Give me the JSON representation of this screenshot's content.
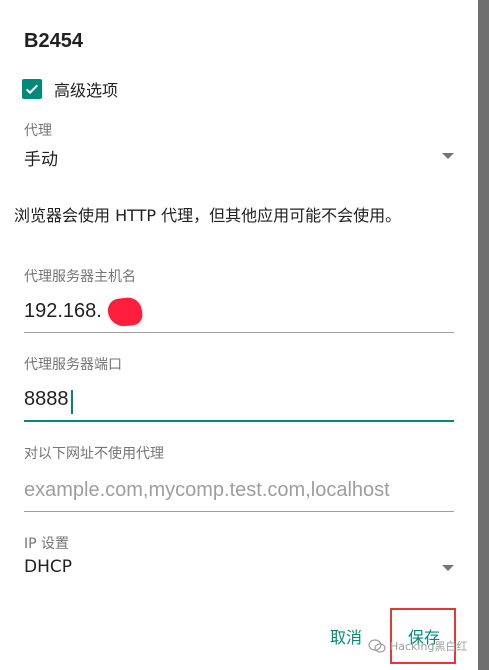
{
  "dialog": {
    "title": "B2454",
    "advanced_label": "高级选项",
    "advanced_checked": true
  },
  "proxy": {
    "label": "代理",
    "value": "手动"
  },
  "note": "浏览器会使用 HTTP 代理，但其他应用可能不会使用。",
  "hostname": {
    "label": "代理服务器主机名",
    "value": "192.168."
  },
  "port": {
    "label": "代理服务器端口",
    "value": "8888"
  },
  "bypass": {
    "label": "对以下网址不使用代理",
    "placeholder": "example.com,mycomp.test.com,localhost"
  },
  "ip": {
    "label": "IP 设置",
    "value": "DHCP"
  },
  "actions": {
    "cancel": "取消",
    "save": "保存"
  },
  "watermark": "Hacking黑白红",
  "colors": {
    "accent": "#00897b",
    "highlight": "#e53935"
  }
}
